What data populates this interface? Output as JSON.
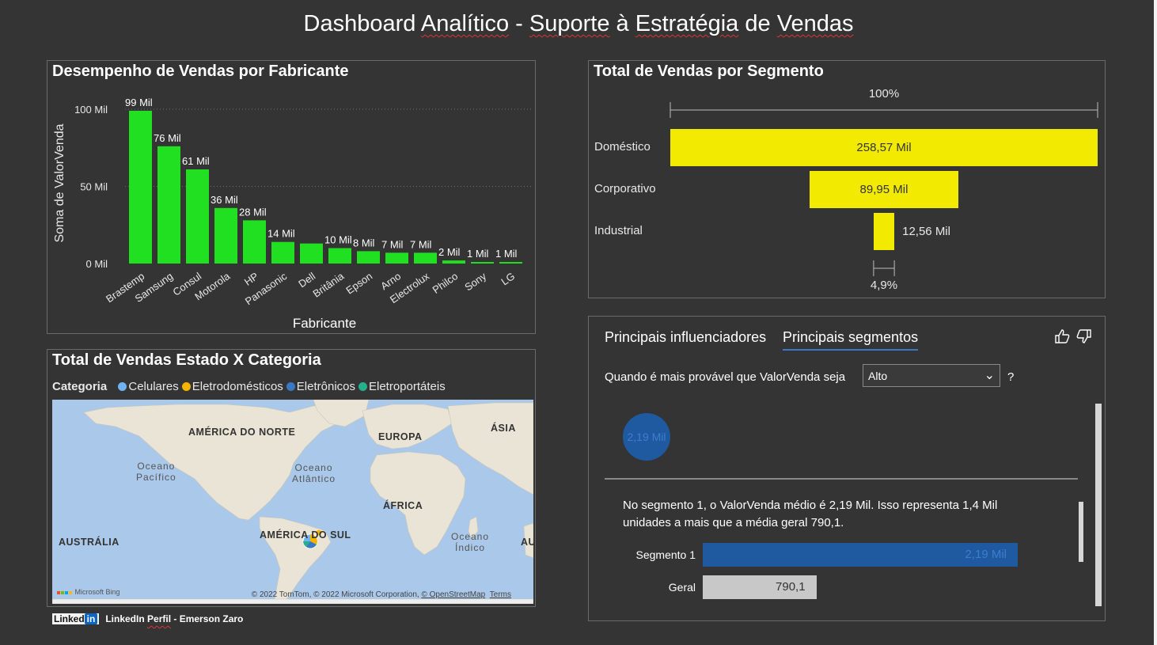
{
  "page": {
    "title_parts": [
      "Dashboard",
      "Analítico",
      "-",
      "Suporte",
      "à",
      "Estratégia",
      "de",
      "Vendas"
    ],
    "footer_linkedin_word": "Linked",
    "footer_linkedin_in": "in",
    "footer_text_a": "LinkedIn ",
    "footer_text_b": "Perfil",
    "footer_text_c": " - Emerson Zaro"
  },
  "bar_panel": {
    "title": "Desempenho de Vendas por Fabricante"
  },
  "chart_data": [
    {
      "type": "bar",
      "title": "Desempenho de Vendas por Fabricante",
      "xlabel": "Fabricante",
      "ylabel": "Soma de ValorVenda",
      "ylim": [
        0,
        100000
      ],
      "yticks": [
        "0 Mil",
        "50 Mil",
        "100 Mil"
      ],
      "ytick_values": [
        0,
        50000,
        100000
      ],
      "categories": [
        "Brastemp",
        "Samsung",
        "Consul",
        "Motorola",
        "HP",
        "Panasonic",
        "Dell",
        "Britânia",
        "Epson",
        "Arno",
        "Electrolux",
        "Philco",
        "Sony",
        "LG"
      ],
      "values": [
        99000,
        76000,
        61000,
        36000,
        28000,
        14000,
        13000,
        10000,
        8000,
        7000,
        7000,
        2000,
        1000,
        1000
      ],
      "data_labels": [
        "99 Mil",
        "76 Mil",
        "61 Mil",
        "36 Mil",
        "28 Mil",
        "14 Mil",
        "",
        "10 Mil",
        "8 Mil",
        "7 Mil",
        "7 Mil",
        "2 Mil",
        "1 Mil",
        "1 Mil"
      ],
      "bar_color": "#21e021",
      "grid": true
    },
    {
      "type": "bar",
      "subtype": "funnel",
      "title": "Total de Vendas por Segmento",
      "categories": [
        "Doméstico",
        "Corporativo",
        "Industrial"
      ],
      "values": [
        258570,
        89950,
        12560
      ],
      "data_labels": [
        "258,57 Mil",
        "89,95 Mil",
        "12,56 Mil"
      ],
      "top_percent": "100%",
      "bottom_percent": "4,9%",
      "bar_color": "#f2ea00"
    }
  ],
  "map_panel": {
    "title": "Total de Vendas Estado X Categoria",
    "legend_title": "Categoria",
    "legend": [
      {
        "name": "Celulares",
        "color": "#6fb3f0"
      },
      {
        "name": "Eletrodomésticos",
        "color": "#f5b400"
      },
      {
        "name": "Eletrônicos",
        "color": "#3b78c3"
      },
      {
        "name": "Eletroportáteis",
        "color": "#23b08b"
      }
    ],
    "labels": {
      "north_america": "AMÉRICA DO NORTE",
      "europe": "EUROPA",
      "asia": "ÁSIA",
      "pacific": "Oceano\nPacífico",
      "atlantic": "Oceano\nAtlântico",
      "africa": "ÁFRICA",
      "south_america": "AMÉRICA DO SUL",
      "australia": "AUSTRÁLIA",
      "indian": "Oceano\nÍndico",
      "au_cut": "AU"
    },
    "bing": "Microsoft Bing",
    "attribution_plain": "© 2022 TomTom, © 2022 Microsoft Corporation, ",
    "attribution_osm": "© OpenStreetMap",
    "attribution_terms": "Terms"
  },
  "influencers": {
    "tab1": "Principais influenciadores",
    "tab2": "Principais segmentos",
    "question": "Quando é mais provável que ValorVenda seja",
    "select_value": "Alto",
    "qmark": "?",
    "circle_value": "2,19 Mil",
    "description": "No segmento 1, o ValorVenda médio é 2,19 Mil. Isso representa 1,4 Mil unidades a mais que a média geral 790,1.",
    "rows": [
      {
        "label": "Segmento 1",
        "value_text": "2,19 Mil",
        "value": 2190,
        "color": "#1f5aa0",
        "text_color": "#3d7dd0"
      },
      {
        "label": "Geral",
        "value_text": "790,1",
        "value": 790.1,
        "color": "#c8c8c8",
        "text_color": "#333333"
      }
    ]
  }
}
